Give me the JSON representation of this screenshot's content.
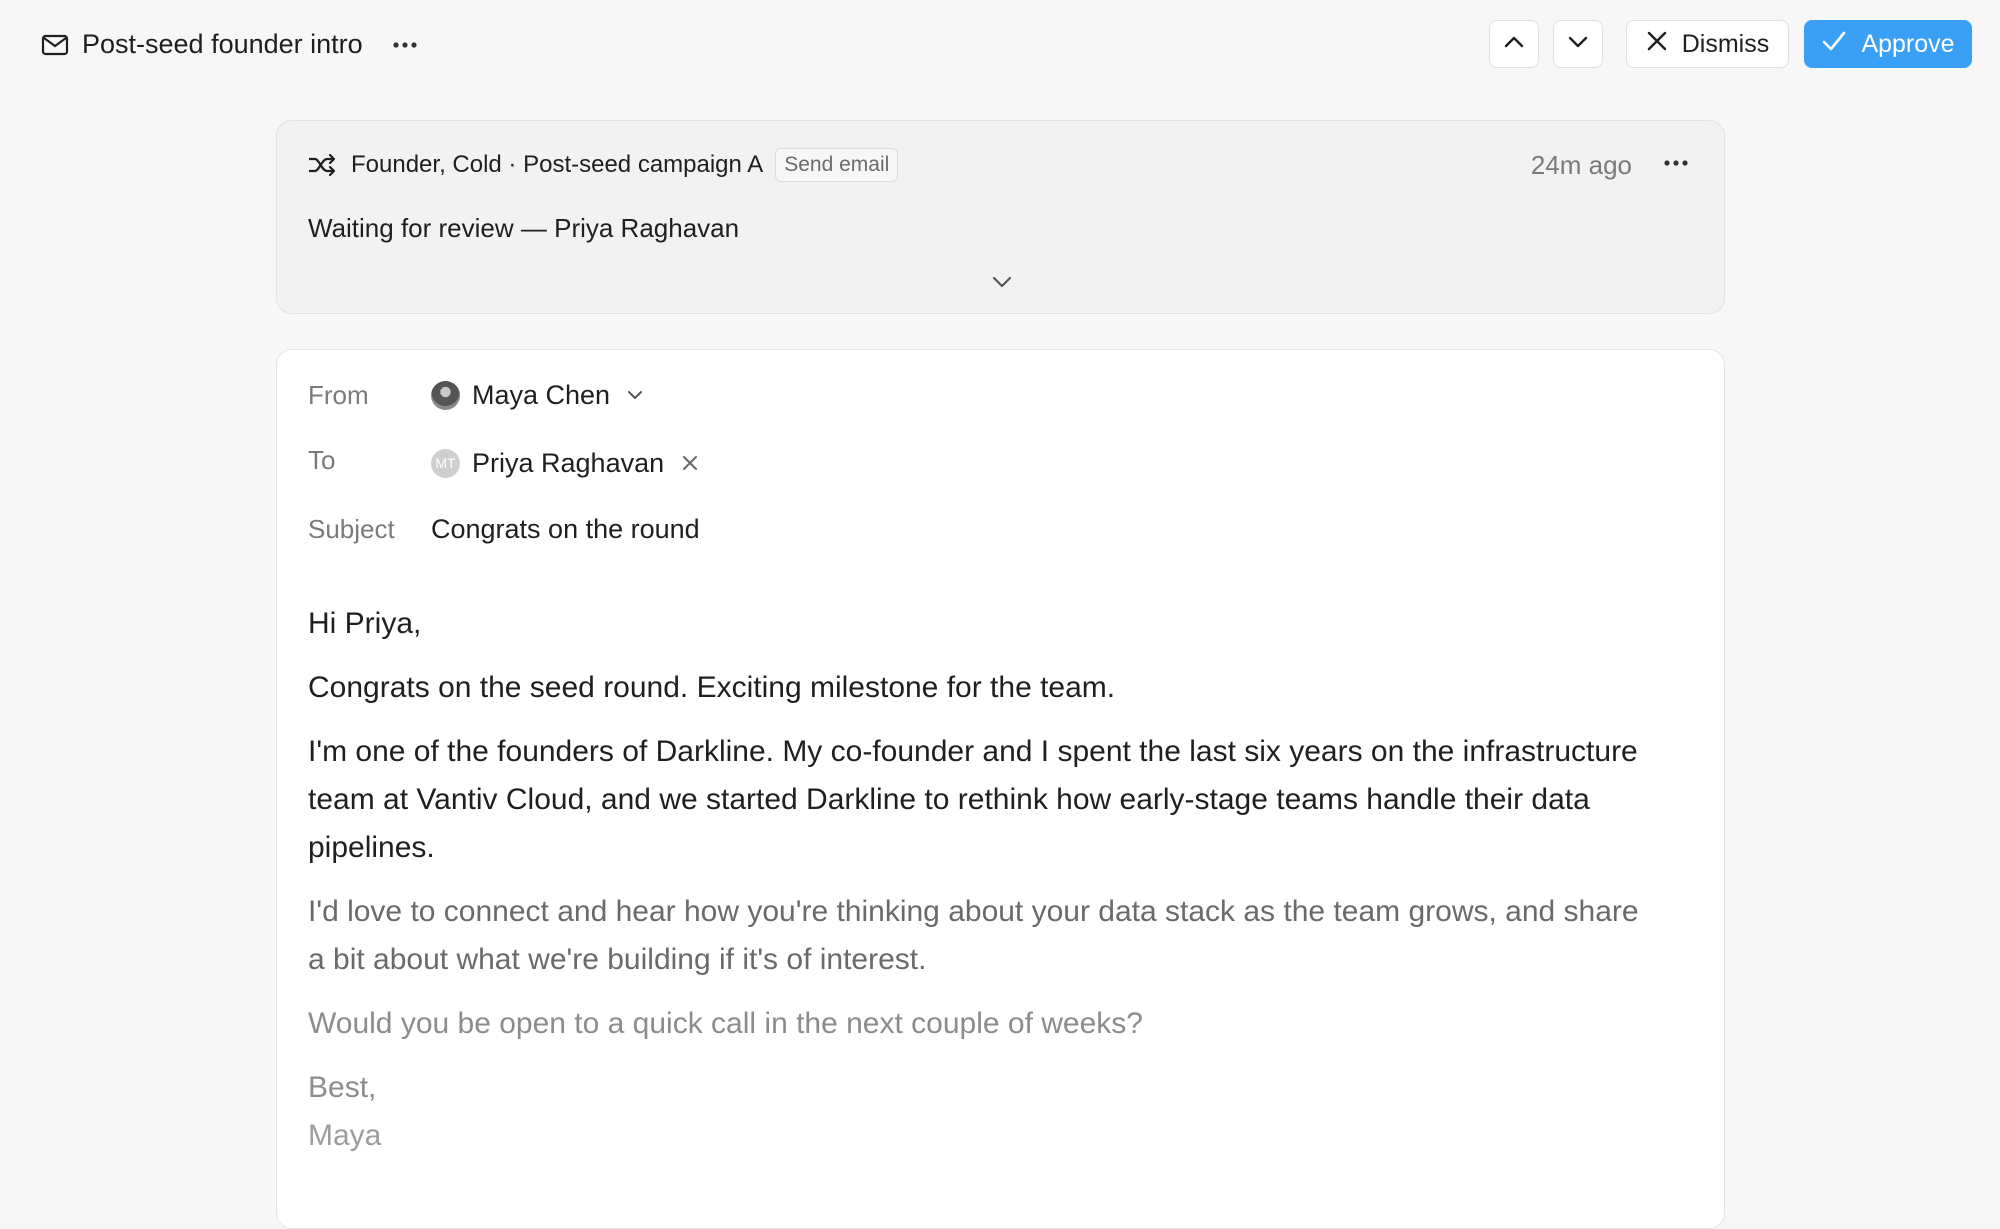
{
  "header": {
    "title": "Post-seed founder intro",
    "dismiss_label": "Dismiss",
    "approve_label": "Approve",
    "accent_color": "#3aa0f5"
  },
  "status_card": {
    "campaign": "Founder, Cold · Post-seed campaign A",
    "tag": "Send email",
    "time": "24m ago",
    "status": "Waiting for review — Priya Raghavan"
  },
  "email": {
    "from_label": "From",
    "from_name": "Maya Chen",
    "to_label": "To",
    "to_initials": "MT",
    "to_name": "Priya Raghavan",
    "subject_label": "Subject",
    "subject": "Congrats on the round",
    "body": {
      "greeting": "Hi Priya,",
      "p1": "Congrats on the seed round. Exciting milestone for the team.",
      "p2": "I'm one of the founders of Darkline. My co-founder and I spent the last six years on the infrastructure team at Vantiv Cloud, and we started Darkline to rethink how early-stage teams handle their data pipelines.",
      "p3": "I'd love to connect and hear how you're thinking about your data stack as the team grows, and share a bit about what we're building if it's of interest.",
      "p4": "Would you be open to a quick call in the next couple of weeks?",
      "signoff": "Best,",
      "signature": "Maya"
    }
  }
}
